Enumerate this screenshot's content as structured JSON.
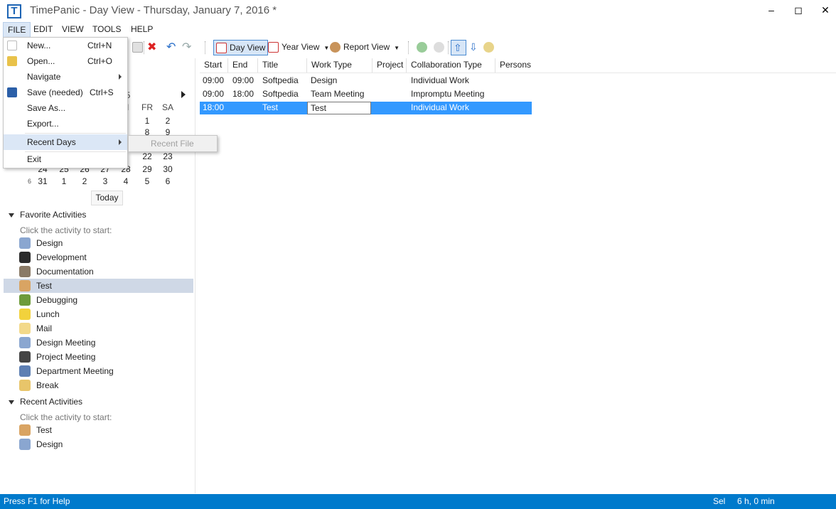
{
  "window": {
    "title": "TimePanic - Day View - Thursday, January 7, 2016 *",
    "app_icon_letter": "T"
  },
  "menubar": [
    "FILE",
    "EDIT",
    "VIEW",
    "TOOLS",
    "HELP"
  ],
  "toolbar": {
    "day_view": "Day View",
    "year_view": "Year View",
    "report_view": "Report View"
  },
  "calendar": {
    "visible_header_fragment": "5",
    "day_heads": [
      "H",
      "FR",
      "SA"
    ],
    "rows": [
      {
        "week": "",
        "days": [
          "",
          "",
          "",
          "",
          "1",
          "1",
          "2"
        ]
      },
      {
        "week": "",
        "days": [
          "",
          "",
          "",
          "",
          "7",
          "8",
          "9"
        ]
      },
      {
        "week": "",
        "days": [
          "",
          "",
          "",
          "",
          "",
          "",
          ""
        ]
      },
      {
        "week": "",
        "days": [
          "",
          "",
          "",
          "",
          "1",
          "22",
          "23"
        ]
      },
      {
        "week": "",
        "days": [
          "24",
          "25",
          "26",
          "27",
          "28",
          "29",
          "30"
        ]
      },
      {
        "week": "6",
        "days": [
          "31",
          "1",
          "2",
          "3",
          "4",
          "5",
          "6"
        ]
      }
    ],
    "today_label": "Today"
  },
  "favorites": {
    "heading": "Favorite Activities",
    "hint": "Click the activity to start:",
    "items": [
      "Design",
      "Development",
      "Documentation",
      "Test",
      "Debugging",
      "Lunch",
      "Mail",
      "Design Meeting",
      "Project Meeting",
      "Department Meeting",
      "Break"
    ],
    "selected": "Test"
  },
  "recent": {
    "heading": "Recent Activities",
    "hint": "Click the activity to start:",
    "items": [
      "Test",
      "Design"
    ]
  },
  "grid": {
    "columns": [
      "Start",
      "End",
      "Title",
      "Work Type",
      "Project",
      "Collaboration Type",
      "Persons"
    ],
    "rows": [
      {
        "start": "09:00",
        "end": "09:00",
        "title": "Softpedia",
        "work_type": "Design",
        "project": "",
        "collaboration": "Individual Work",
        "persons": ""
      },
      {
        "start": "09:00",
        "end": "18:00",
        "title": "Softpedia",
        "work_type": "Team Meeting",
        "project": "",
        "collaboration": "Impromptu Meeting",
        "persons": ""
      },
      {
        "start": "18:00",
        "end": "",
        "title": "Test",
        "work_type": "Test",
        "project": "",
        "collaboration": "Individual Work",
        "persons": ""
      }
    ]
  },
  "file_menu": {
    "items": [
      {
        "label": "New...",
        "shortcut": "Ctrl+N"
      },
      {
        "label": "Open...",
        "shortcut": "Ctrl+O"
      },
      {
        "label": "Navigate",
        "shortcut": ""
      },
      {
        "label": "Save (needed)",
        "shortcut": "Ctrl+S"
      },
      {
        "label": "Save As...",
        "shortcut": ""
      },
      {
        "label": "Export...",
        "shortcut": ""
      },
      {
        "label": "Recent Days",
        "shortcut": ""
      },
      {
        "label": "Exit",
        "shortcut": ""
      }
    ],
    "submenu_item": "Recent File"
  },
  "statusbar": {
    "help": "Press F1 for Help",
    "mode": "Sel",
    "total": "6 h, 0 min"
  },
  "colors": {
    "accent": "#007acc",
    "selection": "#3399ff",
    "activity_selected": "#cfd8e6"
  }
}
